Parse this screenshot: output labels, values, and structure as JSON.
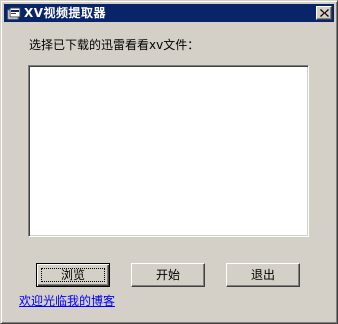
{
  "window": {
    "title": "XV视频提取器"
  },
  "main": {
    "prompt_label": "选择已下载的迅雷看看xv文件：",
    "file_list": []
  },
  "buttons": {
    "browse_label": "浏览",
    "start_label": "开始",
    "exit_label": "退出"
  },
  "footer": {
    "blog_link": "欢迎光临我的博客"
  },
  "colors": {
    "titlebar": "#0a246a",
    "face": "#d4d0c8",
    "link": "#0000ff"
  },
  "icons": {
    "app": "app-icon",
    "close": "close-icon"
  }
}
